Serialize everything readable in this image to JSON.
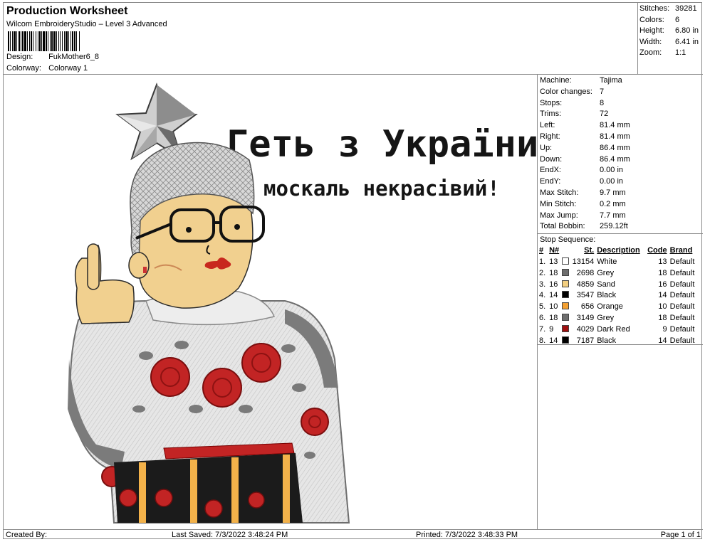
{
  "header": {
    "title": "Production Worksheet",
    "subtitle": "Wilcom EmbroideryStudio – Level 3 Advanced",
    "design_label": "Design:",
    "design_value": "FukMother6_8",
    "colorway_label": "Colorway:",
    "colorway_value": "Colorway 1"
  },
  "summary": [
    {
      "label": "Stitches:",
      "value": "39281"
    },
    {
      "label": "Colors:",
      "value": "6"
    },
    {
      "label": "Height:",
      "value": "6.80 in"
    },
    {
      "label": "Width:",
      "value": "6.41 in"
    },
    {
      "label": "Zoom:",
      "value": "1:1"
    }
  ],
  "design": {
    "line1": "Геть з України,",
    "line2": "москаль некрасівий!"
  },
  "machine_info": [
    {
      "label": "Machine:",
      "value": "Tajima"
    },
    {
      "label": "Color changes:",
      "value": "7"
    },
    {
      "label": "Stops:",
      "value": "8"
    },
    {
      "label": "Trims:",
      "value": "72"
    },
    {
      "label": "Left:",
      "value": "81.4 mm"
    },
    {
      "label": "Right:",
      "value": "81.4 mm"
    },
    {
      "label": "Up:",
      "value": "86.4 mm"
    },
    {
      "label": "Down:",
      "value": "86.4 mm"
    },
    {
      "label": "EndX:",
      "value": "0.00 in"
    },
    {
      "label": "EndY:",
      "value": "0.00 in"
    },
    {
      "label": "Max Stitch:",
      "value": "9.7 mm"
    },
    {
      "label": "Min Stitch:",
      "value": "0.2 mm"
    },
    {
      "label": "Max Jump:",
      "value": "7.7 mm"
    },
    {
      "label": "Total Bobbin:",
      "value": "259.12ft"
    }
  ],
  "stop_sequence": {
    "title": "Stop Sequence:",
    "columns": {
      "idx": "#",
      "n": "N#",
      "st": "St.",
      "desc": "Description",
      "code": "Code",
      "brand": "Brand"
    },
    "rows": [
      {
        "idx": "1.",
        "n": "13",
        "color": "#ffffff",
        "st": "13154",
        "desc": "White",
        "code": "13",
        "brand": "Default"
      },
      {
        "idx": "2.",
        "n": "18",
        "color": "#6e6e6e",
        "st": "2698",
        "desc": "Grey",
        "code": "18",
        "brand": "Default"
      },
      {
        "idx": "3.",
        "n": "16",
        "color": "#f3cf80",
        "st": "4859",
        "desc": "Sand",
        "code": "16",
        "brand": "Default"
      },
      {
        "idx": "4.",
        "n": "14",
        "color": "#000000",
        "st": "3547",
        "desc": "Black",
        "code": "14",
        "brand": "Default"
      },
      {
        "idx": "5.",
        "n": "10",
        "color": "#f4a030",
        "st": "656",
        "desc": "Orange",
        "code": "10",
        "brand": "Default"
      },
      {
        "idx": "6.",
        "n": "18",
        "color": "#6e6e6e",
        "st": "3149",
        "desc": "Grey",
        "code": "18",
        "brand": "Default"
      },
      {
        "idx": "7.",
        "n": "9",
        "color": "#a01010",
        "st": "4029",
        "desc": "Dark Red",
        "code": "9",
        "brand": "Default"
      },
      {
        "idx": "8.",
        "n": "14",
        "color": "#000000",
        "st": "7187",
        "desc": "Black",
        "code": "14",
        "brand": "Default"
      }
    ]
  },
  "footer": {
    "created_by": "Created By:",
    "last_saved": "Last Saved: 7/3/2022 3:48:24 PM",
    "printed": "Printed: 7/3/2022 3:48:33 PM",
    "page": "Page 1 of 1"
  }
}
